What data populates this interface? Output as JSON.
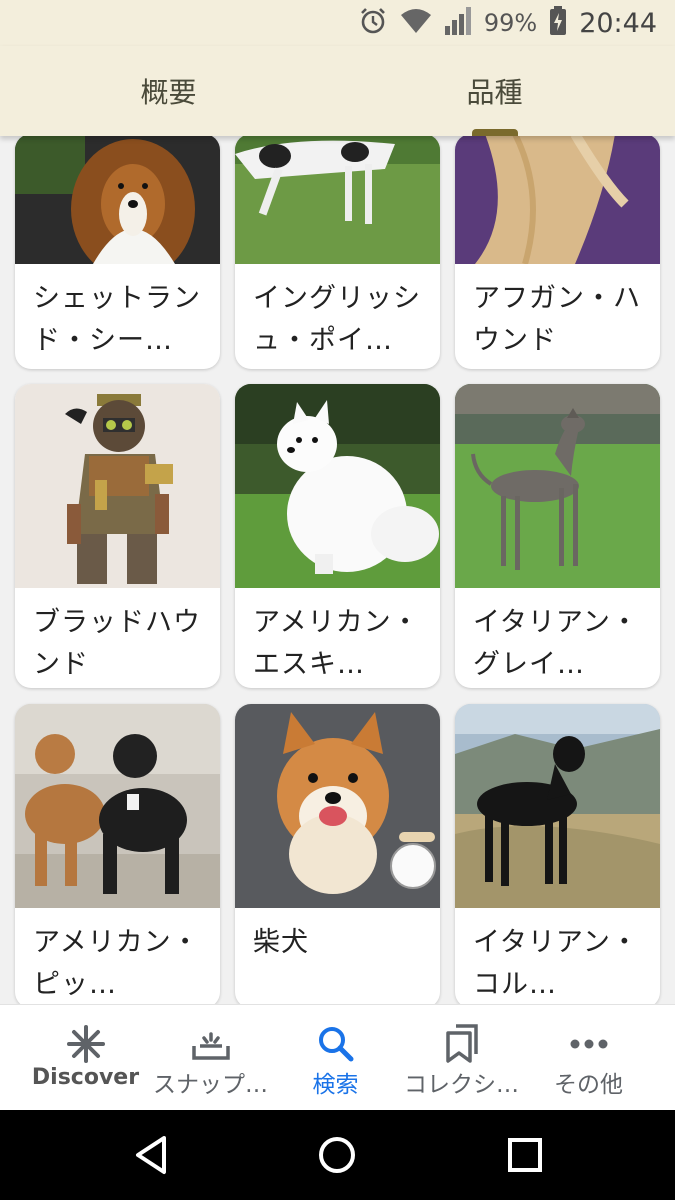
{
  "status_bar": {
    "battery_percent": "99%",
    "time": "20:44",
    "icons": [
      "alarm-icon",
      "wifi-icon",
      "signal-icon",
      "battery-charging-icon"
    ]
  },
  "tabs": [
    {
      "label": "概要",
      "selected": false
    },
    {
      "label": "品種",
      "selected": true
    }
  ],
  "breeds": [
    {
      "label": "シェットランド・シー…"
    },
    {
      "label": "イングリッシュ・ポイ…"
    },
    {
      "label": "アフガン・ハウンド"
    },
    {
      "label": "ブラッドハウンド"
    },
    {
      "label": "アメリカン・エスキ…"
    },
    {
      "label": "イタリアン・グレイ…"
    },
    {
      "label": "アメリカン・ピッ…"
    },
    {
      "label": "柴犬"
    },
    {
      "label": "イタリアン・コル…"
    }
  ],
  "bottom_nav": [
    {
      "label": "Discover",
      "icon": "asterisk-icon"
    },
    {
      "label": "スナップ…",
      "icon": "snapshot-icon"
    },
    {
      "label": "検索",
      "icon": "search-icon",
      "active": true
    },
    {
      "label": "コレクシ…",
      "icon": "collections-icon"
    },
    {
      "label": "その他",
      "icon": "more-icon"
    }
  ],
  "colors": {
    "header_bg": "#f3eedc",
    "tab_indicator": "#7a6a2c",
    "active_blue": "#1a73e8"
  }
}
